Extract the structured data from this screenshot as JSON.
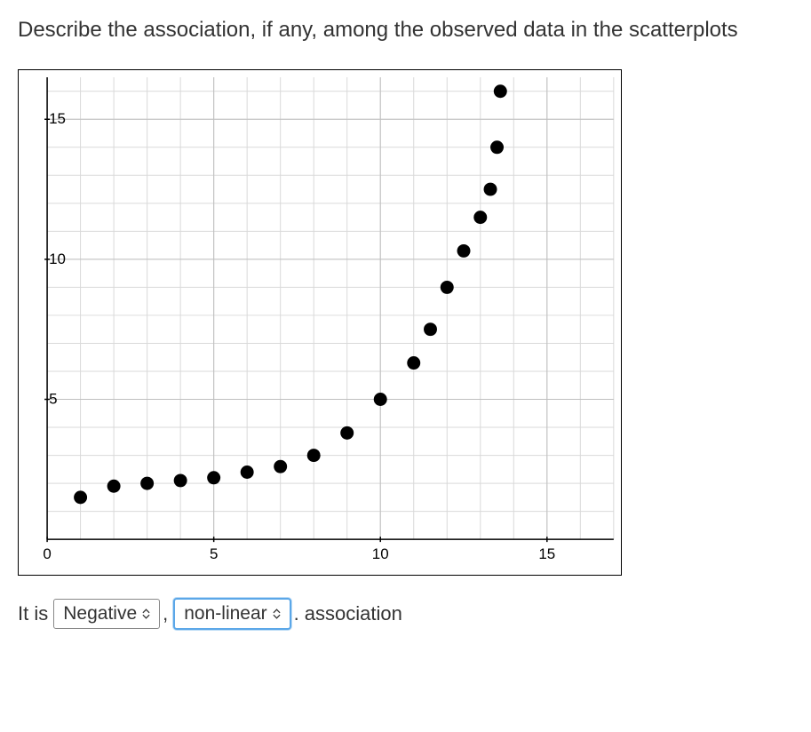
{
  "question": "Describe the association, if any, among the observed data in the scatterplots",
  "chart_data": {
    "type": "scatter",
    "title": "",
    "xlabel": "",
    "ylabel": "",
    "xlim": [
      0,
      17
    ],
    "ylim": [
      0,
      16.5
    ],
    "x_ticks": [
      0,
      5,
      10,
      15
    ],
    "y_ticks": [
      5,
      10,
      15
    ],
    "x_tick_labels": [
      "0",
      "5",
      "10",
      "15"
    ],
    "y_tick_labels": [
      "5",
      "10",
      "15"
    ],
    "grid": true,
    "points": [
      {
        "x": 1,
        "y": 1.5
      },
      {
        "x": 2,
        "y": 1.9
      },
      {
        "x": 3,
        "y": 2.0
      },
      {
        "x": 4,
        "y": 2.1
      },
      {
        "x": 5,
        "y": 2.2
      },
      {
        "x": 6,
        "y": 2.4
      },
      {
        "x": 7,
        "y": 2.6
      },
      {
        "x": 8,
        "y": 3.0
      },
      {
        "x": 9,
        "y": 3.8
      },
      {
        "x": 10,
        "y": 5.0
      },
      {
        "x": 11,
        "y": 6.3
      },
      {
        "x": 11.5,
        "y": 7.5
      },
      {
        "x": 12,
        "y": 9.0
      },
      {
        "x": 12.5,
        "y": 10.3
      },
      {
        "x": 13,
        "y": 11.5
      },
      {
        "x": 13.3,
        "y": 12.5
      },
      {
        "x": 13.5,
        "y": 14.0
      },
      {
        "x": 13.6,
        "y": 16.0
      }
    ]
  },
  "answer": {
    "prefix": "It is",
    "select1_value": "Negative",
    "comma": ",",
    "select2_value": "non-linear",
    "period": ".",
    "suffix": "association"
  }
}
